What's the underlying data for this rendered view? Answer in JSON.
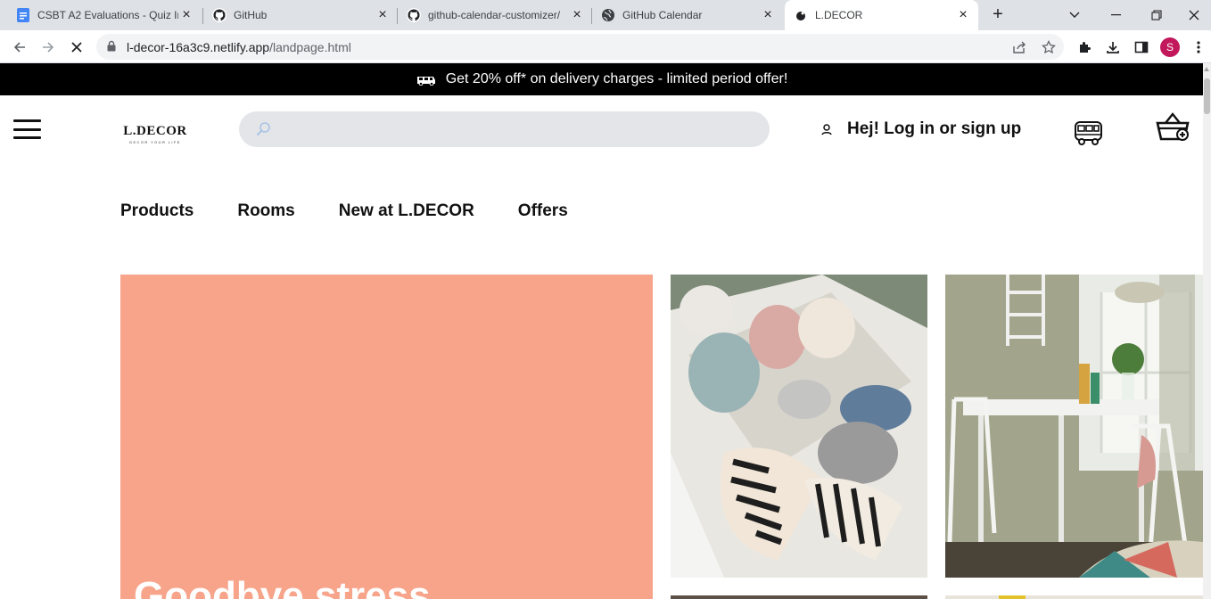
{
  "browser": {
    "tabs": [
      {
        "title": "CSBT A2 Evaluations - Quiz In",
        "icon": "google-docs-icon",
        "active": false
      },
      {
        "title": "GitHub",
        "icon": "github-icon",
        "active": false
      },
      {
        "title": "github-calendar-customizer/",
        "icon": "github-icon",
        "active": false
      },
      {
        "title": "GitHub Calendar",
        "icon": "globe-icon",
        "active": false
      },
      {
        "title": "L.DECOR",
        "icon": "site-icon",
        "active": true
      }
    ],
    "url_host": "l-decor-16a3c9.netlify.app",
    "url_path": "/landpage.html",
    "profile_initial": "S"
  },
  "page": {
    "promo_text": "Get 20% off* on delivery charges - limited period offer!",
    "logo_text": "L.DECOR",
    "logo_tagline": "DECOR YOUR LIFE",
    "search_value": "",
    "login_text": "Hej! Log in or sign up",
    "nav": [
      "Products",
      "Rooms",
      "New at L.DECOR",
      "Offers"
    ],
    "hero_headline": "Goodbye stress",
    "colors": {
      "promo_bg": "#000000",
      "hero_bg": "#f7a48b",
      "search_bg": "#e3e5e9"
    }
  }
}
